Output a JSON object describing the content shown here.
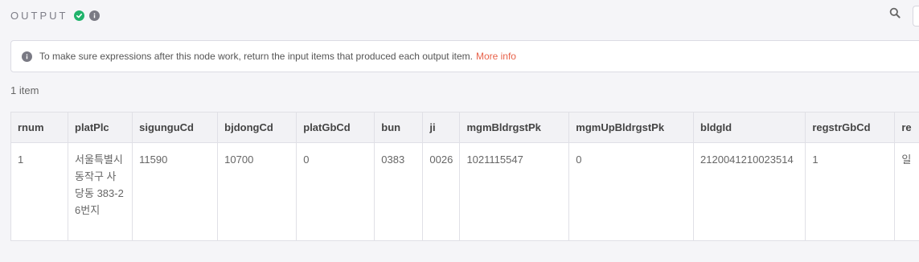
{
  "header": {
    "title": "OUTPUT",
    "status_ok_icon": "check-circle-icon",
    "info_icon": "info-icon",
    "search_icon": "search-icon"
  },
  "notice": {
    "icon": "info-icon",
    "text": "To make sure expressions after this node work, return the input items that produced each output item.",
    "link": "More info"
  },
  "item_count": "1 item",
  "table": {
    "columns": [
      "rnum",
      "platPlc",
      "sigunguCd",
      "bjdongCd",
      "platGbCd",
      "bun",
      "ji",
      "mgmBldrgstPk",
      "mgmUpBldrgstPk",
      "bldgId",
      "regstrGbCd",
      "re"
    ],
    "rows": [
      [
        "1",
        "서울특별시 동작구 사당동 383-26번지",
        "11590",
        "10700",
        "0",
        "0383",
        "0026",
        "1021115547",
        "0",
        "2120041210023514",
        "1",
        "일"
      ]
    ]
  },
  "colors": {
    "accent_link": "#e8624a",
    "status_ok": "#20b36b"
  }
}
